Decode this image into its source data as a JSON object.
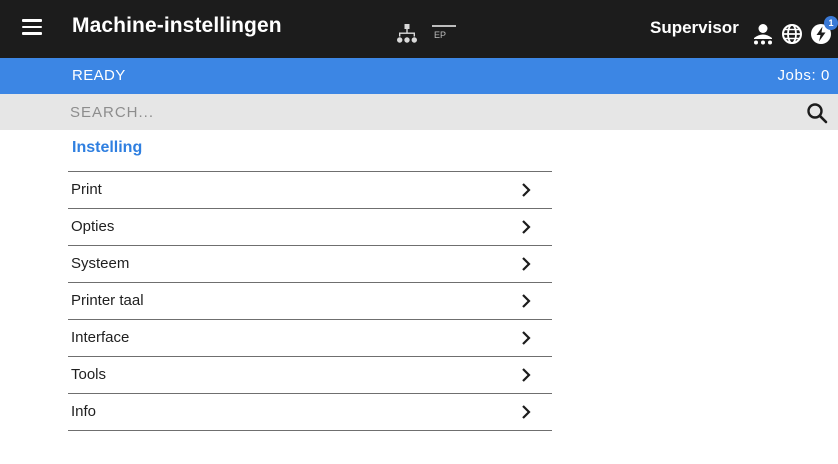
{
  "header": {
    "title": "Machine-instellingen",
    "ep_label": "EP",
    "role": "Supervisor",
    "notification_count": "1",
    "icons": [
      "menu-icon",
      "network-icon",
      "ep-icon",
      "user-icon",
      "globe-icon",
      "power-icon"
    ]
  },
  "status": {
    "state": "READY",
    "jobs": "Jobs: 0"
  },
  "search": {
    "placeholder": "SEARCH..."
  },
  "section": {
    "heading": "Instelling"
  },
  "menu": {
    "items": [
      {
        "label": "Print"
      },
      {
        "label": "Opties"
      },
      {
        "label": "Systeem"
      },
      {
        "label": "Printer taal"
      },
      {
        "label": "Interface"
      },
      {
        "label": "Tools"
      },
      {
        "label": "Info"
      }
    ]
  },
  "colors": {
    "header_bg": "#1c1c1c",
    "status_bg": "#3c86e4",
    "search_bg": "#e6e6e6",
    "accent": "#2f7fe0",
    "badge_bg": "#3a79d6"
  }
}
